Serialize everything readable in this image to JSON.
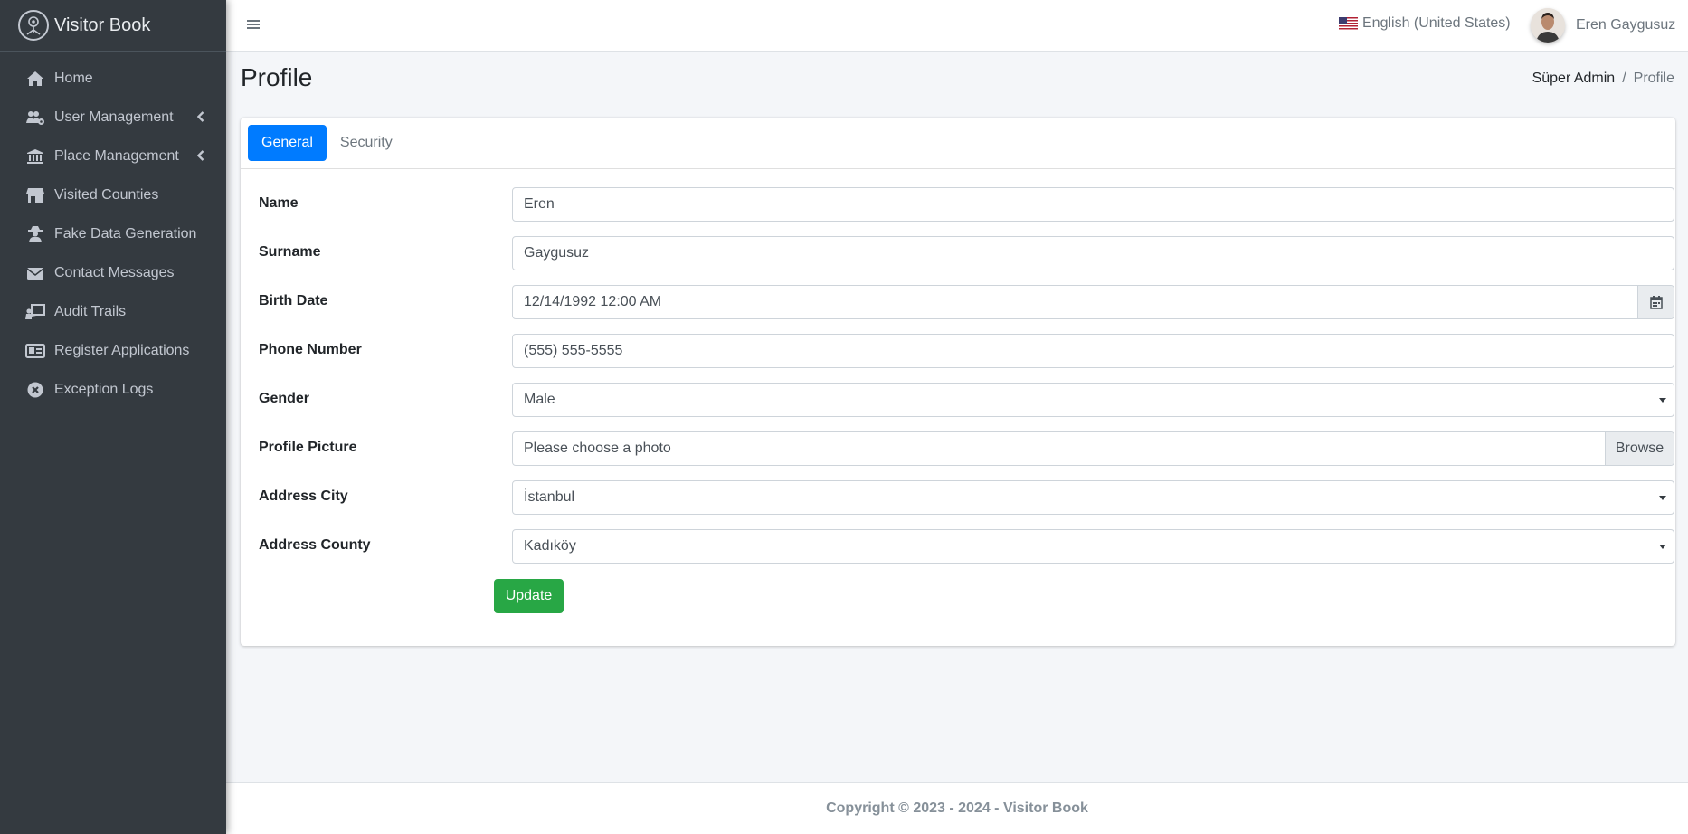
{
  "brand": {
    "name": "Visitor Book"
  },
  "sidebar": {
    "items": [
      {
        "label": "Home",
        "icon": "home-icon",
        "has_children": false
      },
      {
        "label": "User Management",
        "icon": "users-cog-icon",
        "has_children": true
      },
      {
        "label": "Place Management",
        "icon": "landmark-icon",
        "has_children": true
      },
      {
        "label": "Visited Counties",
        "icon": "store-icon",
        "has_children": false
      },
      {
        "label": "Fake Data Generation",
        "icon": "user-secret-icon",
        "has_children": false
      },
      {
        "label": "Contact Messages",
        "icon": "envelope-icon",
        "has_children": false
      },
      {
        "label": "Audit Trails",
        "icon": "chalkboard-teacher-icon",
        "has_children": false
      },
      {
        "label": "Register Applications",
        "icon": "id-card-icon",
        "has_children": false
      },
      {
        "label": "Exception Logs",
        "icon": "times-circle-icon",
        "has_children": false
      }
    ]
  },
  "navbar": {
    "language": "English (United States)",
    "user_name": "Eren Gaygusuz"
  },
  "header": {
    "title": "Profile",
    "breadcrumb": {
      "parent": "Süper Admin",
      "separator": "/",
      "current": "Profile"
    }
  },
  "tabs": [
    {
      "label": "General",
      "active": true
    },
    {
      "label": "Security",
      "active": false
    }
  ],
  "form": {
    "name": {
      "label": "Name",
      "value": "Eren"
    },
    "surname": {
      "label": "Surname",
      "value": "Gaygusuz"
    },
    "birth_date": {
      "label": "Birth Date",
      "value": "12/14/1992 12:00 AM"
    },
    "phone": {
      "label": "Phone Number",
      "value": "(555) 555-5555"
    },
    "gender": {
      "label": "Gender",
      "value": "Male"
    },
    "picture": {
      "label": "Profile Picture",
      "placeholder": "Please choose a photo",
      "browse_label": "Browse"
    },
    "city": {
      "label": "Address City",
      "value": "İstanbul"
    },
    "county": {
      "label": "Address County",
      "value": "Kadıköy"
    },
    "update_label": "Update"
  },
  "footer": {
    "text": "Copyright © 2023 - 2024 - Visitor Book"
  },
  "colors": {
    "primary": "#007bff",
    "success": "#28a745",
    "sidebar": "#343a40",
    "sidebar_text": "#c2c7d0"
  }
}
